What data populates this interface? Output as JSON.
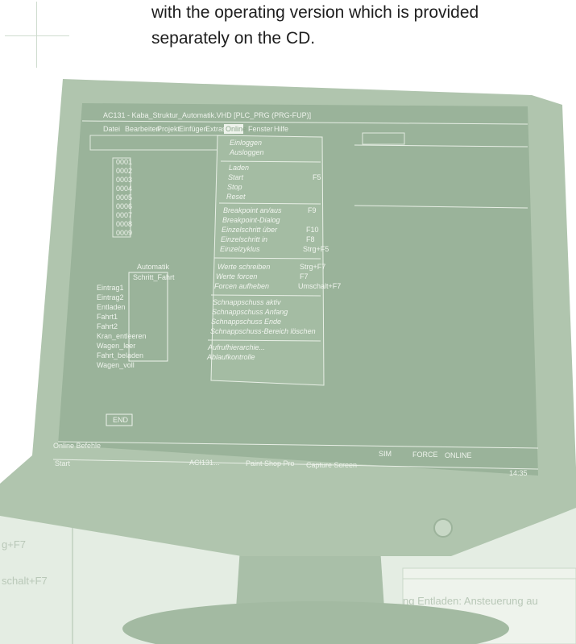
{
  "intro": {
    "line1": "with the operating version which is provided",
    "line2": "separately on the CD."
  },
  "window": {
    "title": "AC131 - Kaba_Struktur_Automatik.VHD [PLC_PRG (PRG-FUP)]",
    "menubar": [
      "Datei",
      "Bearbeiten",
      "Projekt",
      "Einfügen",
      "Extras",
      "Online",
      "Fenster",
      "Hilfe"
    ]
  },
  "online_menu": {
    "items": [
      {
        "label": "Einloggen",
        "key": ""
      },
      {
        "label": "Ausloggen",
        "key": ""
      },
      {
        "label": "Laden",
        "key": ""
      },
      {
        "label": "Start",
        "key": "F5"
      },
      {
        "label": "Stop",
        "key": ""
      },
      {
        "label": "Reset",
        "key": ""
      },
      {
        "label": "Breakpoint an/aus",
        "key": "F9"
      },
      {
        "label": "Breakpoint-Dialog",
        "key": ""
      },
      {
        "label": "Einzelschritt über",
        "key": "F10"
      },
      {
        "label": "Einzelschritt in",
        "key": "F8"
      },
      {
        "label": "Einzelzyklus",
        "key": "Strg+F5"
      },
      {
        "label": "Werte schreiben",
        "key": "Strg+F7"
      },
      {
        "label": "Werte forcen",
        "key": "F7"
      },
      {
        "label": "Forcen aufheben",
        "key": "Umschalt+F7"
      },
      {
        "label": "Schnappschuss aktiv",
        "key": ""
      },
      {
        "label": "Schnappschuss Anfang",
        "key": ""
      },
      {
        "label": "Schnappschuss Ende",
        "key": ""
      },
      {
        "label": "Schnappschuss-Bereich löschen",
        "key": ""
      },
      {
        "label": "Aufrufhierarchie...",
        "key": ""
      },
      {
        "label": "Ablaufkontrolle",
        "key": ""
      }
    ]
  },
  "tree": {
    "lines": [
      "0001",
      "0002",
      "0003",
      "0004",
      "0005",
      "0006",
      "0007",
      "0008",
      "0009"
    ]
  },
  "diagram": {
    "title": "Automatik",
    "box_label": "Schritt_Fahrt",
    "rows": [
      "Eintrag1",
      "Eintrag2",
      "Entladen",
      "Fahrt1",
      "Fahrt2",
      "Kran_entleeren",
      "Wagen_leer",
      "Fahrt_beladen",
      "Wagen_voll"
    ]
  },
  "status": {
    "left": "Online Befehle",
    "right": [
      "SIM",
      "FORCE",
      "ONLINE"
    ],
    "start": "Start",
    "tasks": [
      "ACI131...",
      "Paint Shop Pro",
      "Capture Screen"
    ],
    "clock": "14:35",
    "end_label": "END"
  },
  "background_fragments": {
    "left1": "g+F7",
    "left2": "schalt+F7",
    "right": "ng Entladen: Ansteuerung au"
  },
  "colors": {
    "monitor": "#b0c5ae",
    "screen": "#9ab39a",
    "frame_bg": "#dce6db",
    "outline": "#c9d8c8"
  }
}
